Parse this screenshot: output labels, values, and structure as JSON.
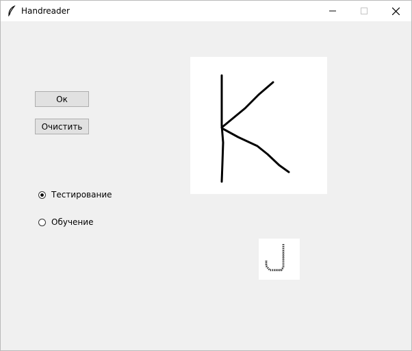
{
  "window": {
    "title": "Handreader",
    "app_icon": "feather-icon",
    "controls": [
      "minimize-icon",
      "maximize-icon",
      "close-icon"
    ]
  },
  "buttons": {
    "ok_label": "Ок",
    "clear_label": "Очистить"
  },
  "mode": {
    "options": [
      {
        "label": "Тестирование",
        "selected": true
      },
      {
        "label": "Обучение",
        "selected": false
      }
    ]
  },
  "drawing": {
    "stroke_color": "#000000",
    "background": "#ffffff"
  },
  "preview": {
    "description_icon": "recognized-glyph",
    "background": "#ffffff"
  }
}
